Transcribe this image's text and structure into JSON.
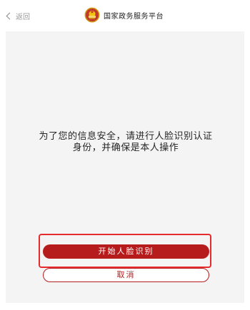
{
  "header": {
    "back_label": "返回",
    "title": "国家政务服务平台"
  },
  "main": {
    "notice_line1": "为了您的信息安全，请进行人脸识别认证",
    "notice_line2": "身份，并确保是本人操作"
  },
  "actions": {
    "start_label": "开始人脸识别",
    "cancel_label": "取消"
  },
  "colors": {
    "primary": "#b71c1c",
    "highlight": "#e52b2b",
    "content_bg": "#f4f4f4",
    "emblem_red": "#c0392b",
    "emblem_gold": "#f1c40f"
  },
  "icons": {
    "back": "chevron-left-icon",
    "emblem": "national-emblem-icon"
  }
}
